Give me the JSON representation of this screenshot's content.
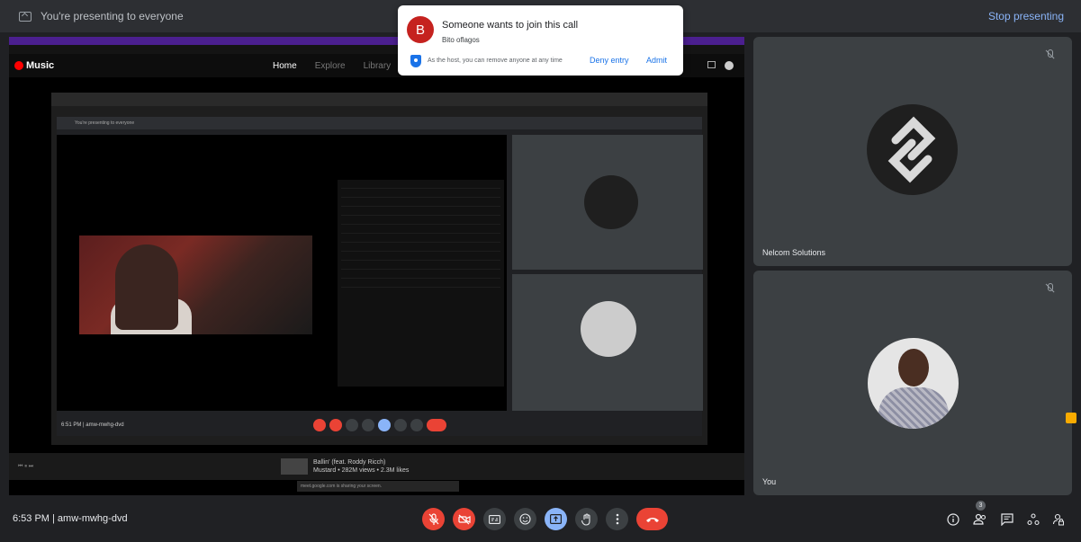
{
  "topbar": {
    "presenting_text": "You're presenting to everyone",
    "stop_label": "Stop presenting"
  },
  "shared_screen": {
    "ytm": {
      "logo_text": "Music",
      "nav": [
        "Home",
        "Explore",
        "Library"
      ]
    },
    "inner_meet": {
      "presenting_text": "You're presenting to everyone",
      "time": "6:51 PM  |  amw-mwhg-dvd"
    },
    "player": {
      "track_title": "Ballin' (feat. Roddy Ricch)",
      "track_meta": "Mustard • 282M views • 2.3M likes"
    },
    "sharing_notice": "meet.google.com is sharing your screen."
  },
  "tiles": [
    {
      "name": "Nelcom Solutions"
    },
    {
      "name": "You"
    }
  ],
  "notification": {
    "avatar_letter": "B",
    "title": "Someone wants to join this call",
    "requester": "Bito oflagos",
    "host_note": "As the host, you can remove anyone at any time",
    "deny_label": "Deny entry",
    "admit_label": "Admit"
  },
  "bottombar": {
    "meeting_info": "6:53 PM  |  amw-mwhg-dvd",
    "participant_count": "3"
  },
  "colors": {
    "background": "#202124",
    "tile": "#3c4043",
    "accent_blue": "#1a73e8",
    "end_red": "#ea4335"
  }
}
